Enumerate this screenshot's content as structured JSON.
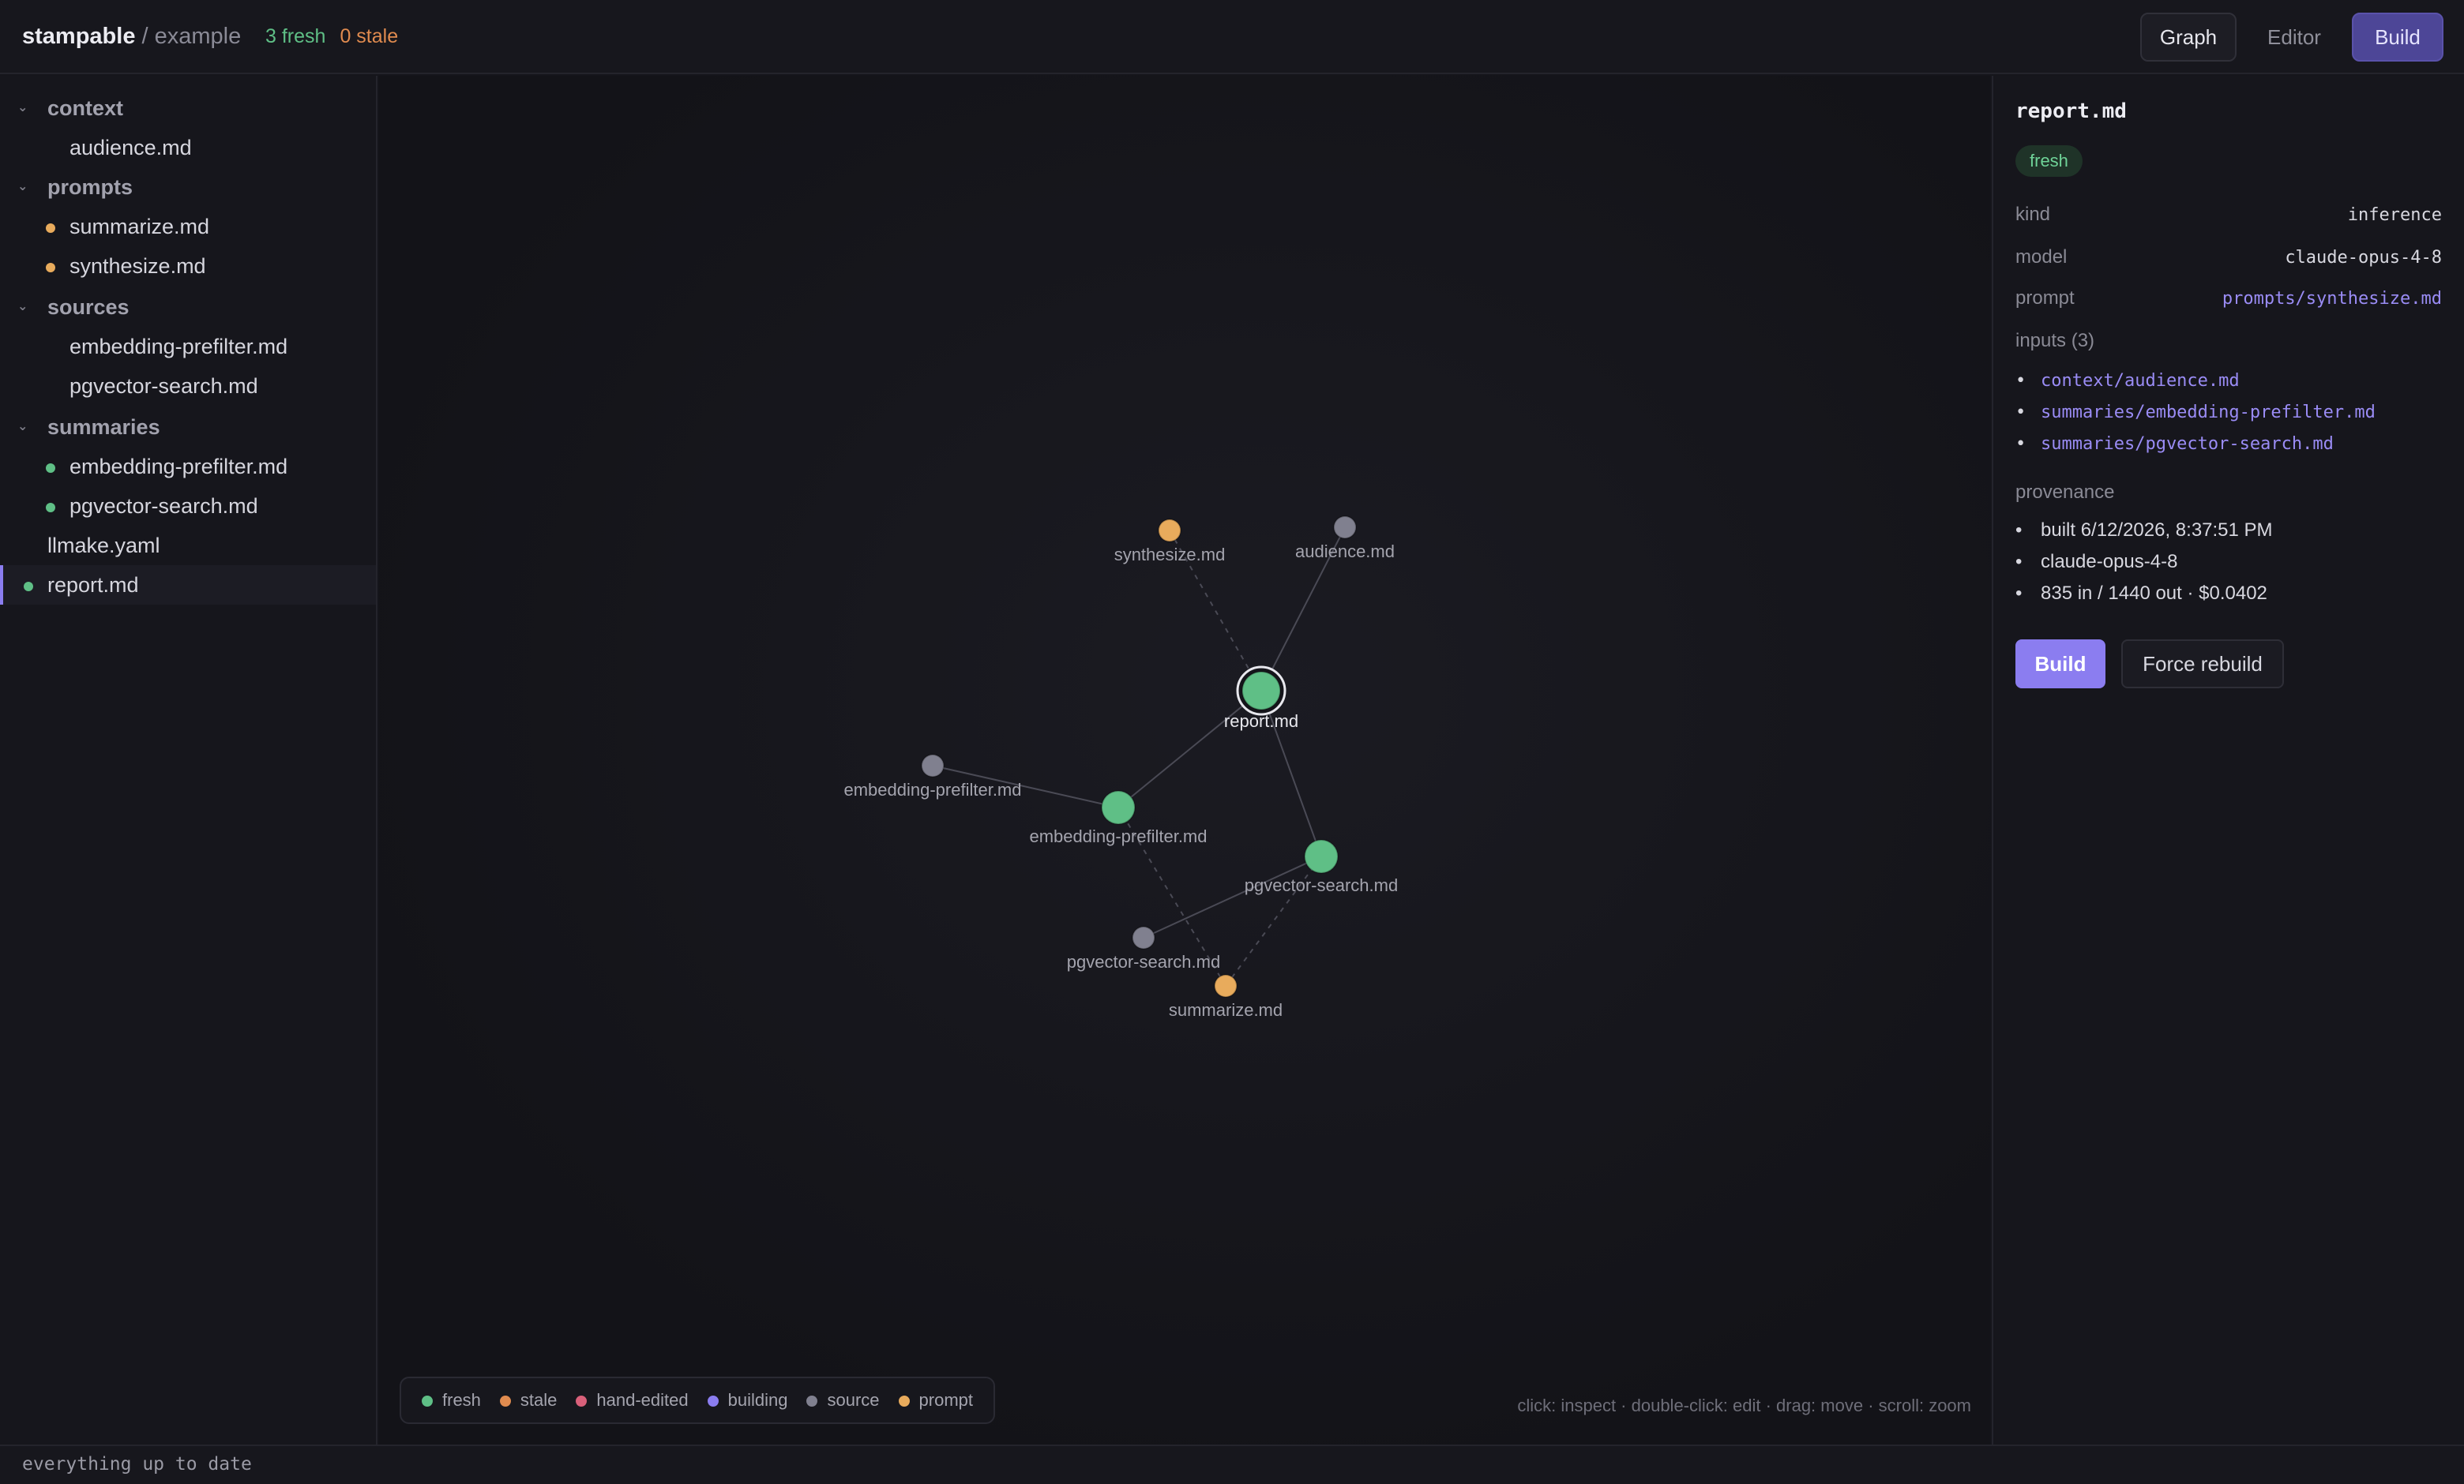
{
  "header": {
    "project": "stampable",
    "separator": " / ",
    "workspace": "example",
    "fresh_count": "3 fresh",
    "stale_count": "0 stale",
    "tabs": {
      "graph": "Graph",
      "editor": "Editor",
      "build": "Build"
    }
  },
  "sidebar": {
    "rows": [
      {
        "kind": "folder",
        "label": "context",
        "chevron": "⌄"
      },
      {
        "kind": "file",
        "label": "audience.md",
        "dot": null
      },
      {
        "kind": "folder",
        "label": "prompts",
        "chevron": "⌄"
      },
      {
        "kind": "file",
        "label": "summarize.md",
        "dot": "prompt"
      },
      {
        "kind": "file",
        "label": "synthesize.md",
        "dot": "prompt"
      },
      {
        "kind": "folder",
        "label": "sources",
        "chevron": "⌄"
      },
      {
        "kind": "file",
        "label": "embedding-prefilter.md",
        "dot": null
      },
      {
        "kind": "file",
        "label": "pgvector-search.md",
        "dot": null
      },
      {
        "kind": "folder",
        "label": "summaries",
        "chevron": "⌄"
      },
      {
        "kind": "file",
        "label": "embedding-prefilter.md",
        "dot": "fresh"
      },
      {
        "kind": "file",
        "label": "pgvector-search.md",
        "dot": "fresh"
      },
      {
        "kind": "root",
        "label": "llmake.yaml",
        "dot": null
      },
      {
        "kind": "root",
        "label": "report.md",
        "dot": "fresh",
        "selected": true
      }
    ]
  },
  "colors": {
    "fresh": "#5fbf86",
    "stale": "#e08b4f",
    "hand_edited": "#d9607a",
    "building": "#8b7df0",
    "source": "#80808f",
    "prompt": "#e8ab5c",
    "accent": "#8b7df0"
  },
  "graph": {
    "nodes": [
      {
        "id": "synthesize",
        "label": "synthesize.md",
        "status": "prompt"
      },
      {
        "id": "audience",
        "label": "audience.md",
        "status": "source"
      },
      {
        "id": "report",
        "label": "report.md",
        "status": "fresh",
        "selected": true
      },
      {
        "id": "src-embedding",
        "label": "embedding-prefilter.md",
        "status": "source"
      },
      {
        "id": "sum-embedding",
        "label": "embedding-prefilter.md",
        "status": "fresh"
      },
      {
        "id": "sum-pgvector",
        "label": "pgvector-search.md",
        "status": "fresh"
      },
      {
        "id": "src-pgvector",
        "label": "pgvector-search.md",
        "status": "source"
      },
      {
        "id": "summarize",
        "label": "summarize.md",
        "status": "prompt"
      }
    ],
    "edges": [
      {
        "from": "synthesize",
        "to": "report",
        "dashed": true
      },
      {
        "from": "audience",
        "to": "report",
        "dashed": false
      },
      {
        "from": "sum-embedding",
        "to": "report",
        "dashed": false
      },
      {
        "from": "sum-pgvector",
        "to": "report",
        "dashed": false
      },
      {
        "from": "src-embedding",
        "to": "sum-embedding",
        "dashed": false
      },
      {
        "from": "src-pgvector",
        "to": "sum-pgvector",
        "dashed": false
      },
      {
        "from": "summarize",
        "to": "sum-embedding",
        "dashed": true
      },
      {
        "from": "summarize",
        "to": "sum-pgvector",
        "dashed": true
      }
    ]
  },
  "legend": [
    {
      "label": "fresh",
      "color": "#5fbf86"
    },
    {
      "label": "stale",
      "color": "#e08b4f"
    },
    {
      "label": "hand-edited",
      "color": "#d9607a"
    },
    {
      "label": "building",
      "color": "#8b7df0"
    },
    {
      "label": "source",
      "color": "#80808f"
    },
    {
      "label": "prompt",
      "color": "#e8ab5c"
    }
  ],
  "hint": "click: inspect · double-click: edit · drag: move · scroll: zoom",
  "inspector": {
    "title": "report.md",
    "status": "fresh",
    "kind_label": "kind",
    "kind_value": "inference",
    "model_label": "model",
    "model_value": "claude-opus-4-8",
    "prompt_label": "prompt",
    "prompt_value": "prompts/synthesize.md",
    "inputs_label": "inputs (3)",
    "inputs": [
      "context/audience.md",
      "summaries/embedding-prefilter.md",
      "summaries/pgvector-search.md"
    ],
    "provenance_label": "provenance",
    "provenance": [
      "built 6/12/2026, 8:37:51 PM",
      "claude-opus-4-8",
      "835 in / 1440 out · $0.0402"
    ],
    "build_button": "Build",
    "force_button": "Force rebuild"
  },
  "status_bar": {
    "text": "everything up to date"
  }
}
